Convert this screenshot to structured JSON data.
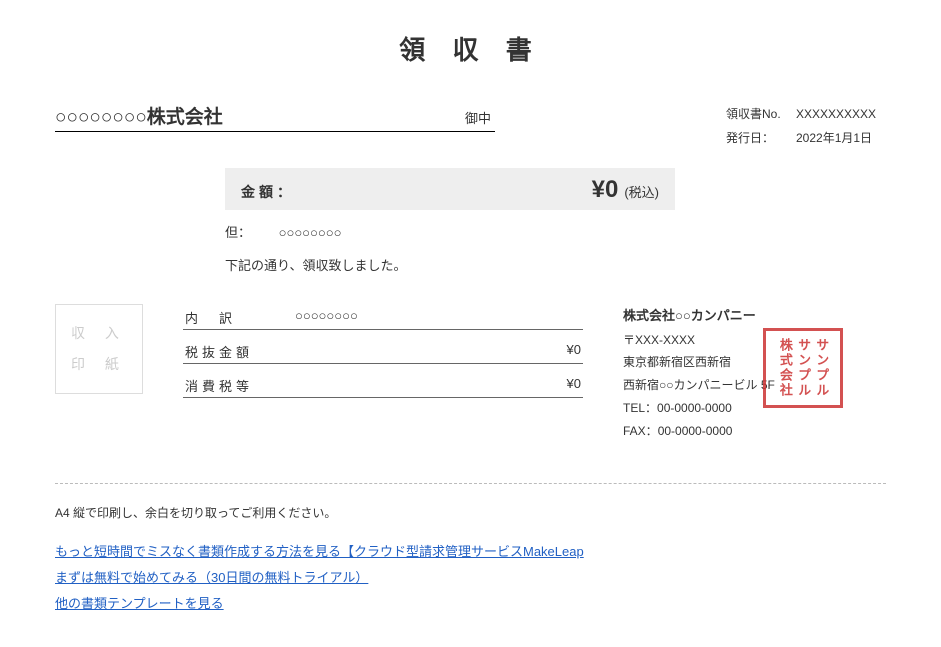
{
  "title": "領 収 書",
  "recipient": {
    "name": "○○○○○○○○株式会社",
    "suffix": "御中"
  },
  "meta": {
    "receipt_no_label": "領収書No.",
    "receipt_no_value": "XXXXXXXXXX",
    "issue_date_label": "発行日：",
    "issue_date_value": "2022年1月1日"
  },
  "amount": {
    "label": "金額：",
    "value": "¥0",
    "tax_note": "(税込)"
  },
  "proviso": {
    "label": "但：",
    "value": "○○○○○○○○"
  },
  "received_text": "下記の通り、領収致しました。",
  "stamp_box_text": "収 入\n印 紙",
  "breakdown": {
    "rows": [
      {
        "label": "内　訳",
        "value": "○○○○○○○○"
      },
      {
        "label": "税抜金額",
        "value": "¥0"
      },
      {
        "label": "消費税等",
        "value": "¥0"
      }
    ]
  },
  "issuer": {
    "name": "株式会社○○カンパニー",
    "postal": "〒XXX-XXXX",
    "address1": "東京都新宿区西新宿",
    "address2": "西新宿○○カンパニービル 5F",
    "tel_label": "TEL：",
    "tel": "00-0000-0000",
    "fax_label": "FAX：",
    "fax": "00-0000-0000"
  },
  "seal_text": "サンプル\nサンプル\n株式会社",
  "print_note": "A4 縦で印刷し、余白を切り取ってご利用ください。",
  "links": [
    "もっと短時間でミスなく書類作成する方法を見る【クラウド型請求管理サービスMakeLeap",
    "まずは無料で始めてみる（30日間の無料トライアル）",
    "他の書類テンプレートを見る"
  ]
}
